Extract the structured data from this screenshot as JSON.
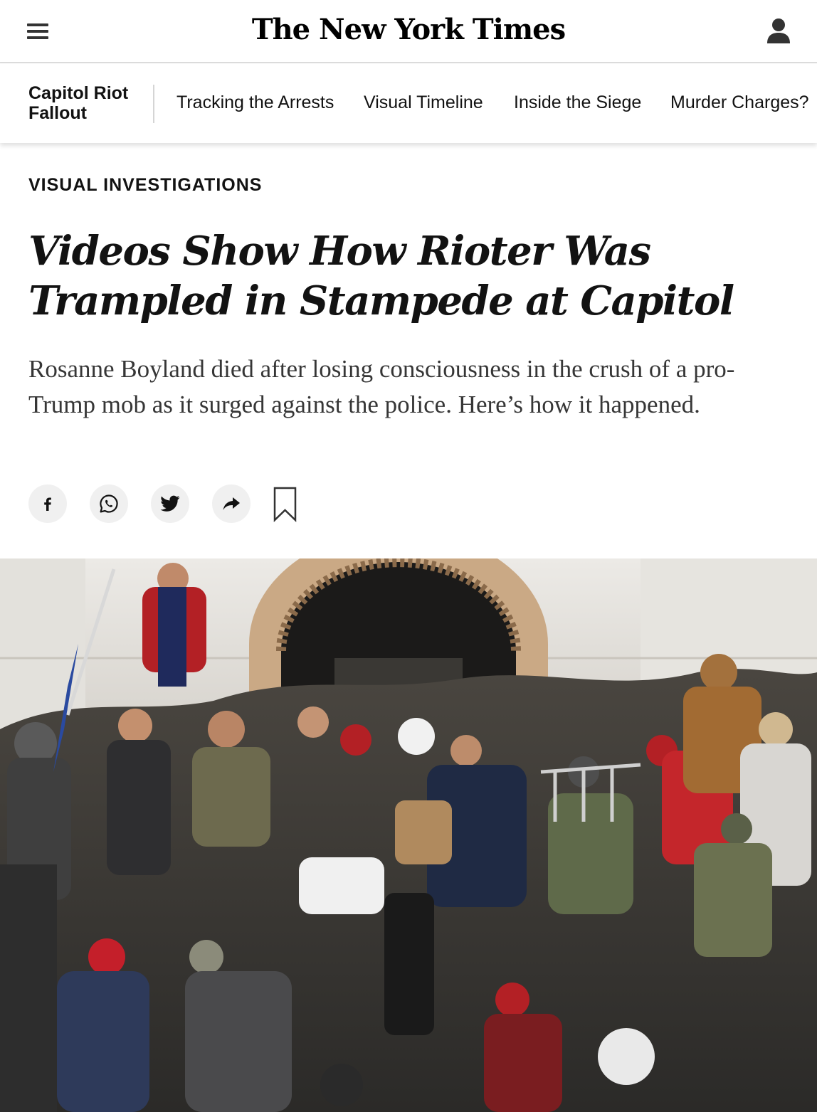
{
  "header": {
    "masthead": "The New York Times"
  },
  "subnav": {
    "section_title_line1": "Capitol Riot",
    "section_title_line2": "Fallout",
    "links": [
      "Tracking the Arrests",
      "Visual Timeline",
      "Inside the Siege",
      "Murder Charges?"
    ]
  },
  "article": {
    "kicker": "VISUAL INVESTIGATIONS",
    "headline": "Videos Show How Rioter Was Trampled in Stampede at Capitol",
    "summary": "Rosanne Boyland died after losing consciousness in the crush of a pro-Trump mob as it surged against the police. Here’s how it happened."
  },
  "share": {
    "icons": [
      "facebook-icon",
      "whatsapp-icon",
      "twitter-icon",
      "share-arrow-icon",
      "bookmark-icon"
    ]
  }
}
